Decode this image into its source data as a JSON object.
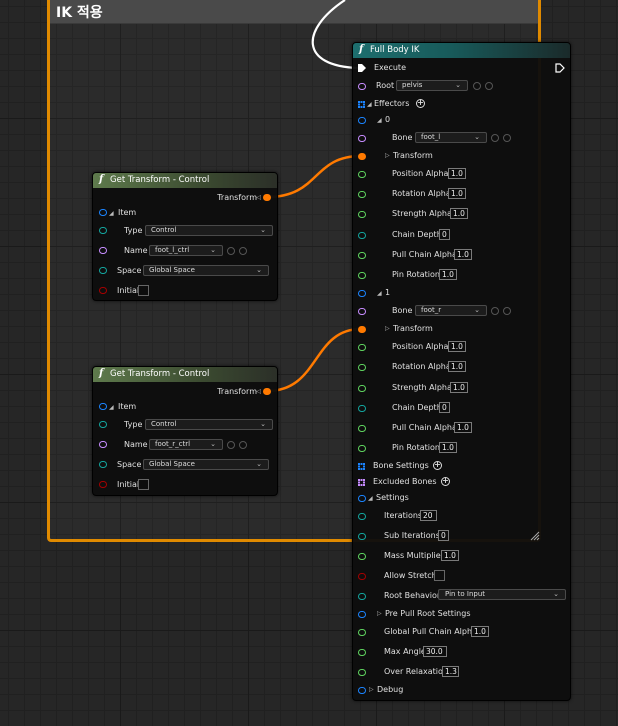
{
  "comment": {
    "title": "IK 적용"
  },
  "colors": {
    "exec": "#ffffff",
    "struct_orange": "#ff7a00",
    "bool_red": "#a50000",
    "float_green": "#5fd35f",
    "name_purple": "#c78cff",
    "enum_teal": "#13a59e",
    "struct_blue": "#1b84ff",
    "comment_border": "#e08a00"
  },
  "wire_color": "#ff7a00",
  "node1": {
    "title": "Get Transform - Control",
    "transform_label": "Transform",
    "item_label": "Item",
    "type_label": "Type",
    "type_value": "Control",
    "name_label": "Name",
    "name_value": "foot_l_ctrl",
    "space_label": "Space",
    "space_value": "Global Space",
    "initial_label": "Initial"
  },
  "node2": {
    "title": "Get Transform - Control",
    "transform_label": "Transform",
    "item_label": "Item",
    "type_label": "Type",
    "type_value": "Control",
    "name_label": "Name",
    "name_value": "foot_r_ctrl",
    "space_label": "Space",
    "space_value": "Global Space",
    "initial_label": "Initial"
  },
  "fbik": {
    "title": "Full Body IK",
    "execute_label": "Execute",
    "root_label": "Root",
    "root_value": "pelvis",
    "effectors_label": "Effectors",
    "effectors": [
      {
        "index": "0",
        "bone_label": "Bone",
        "bone_value": "foot_l",
        "transform_label": "Transform",
        "rows": [
          {
            "label": "Position Alpha",
            "value": "1.0"
          },
          {
            "label": "Rotation Alpha",
            "value": "1.0"
          },
          {
            "label": "Strength Alpha",
            "value": "1.0"
          },
          {
            "label": "Chain Depth",
            "value": "0"
          },
          {
            "label": "Pull Chain Alpha",
            "value": "1.0"
          },
          {
            "label": "Pin Rotation",
            "value": "1.0"
          }
        ]
      },
      {
        "index": "1",
        "bone_label": "Bone",
        "bone_value": "foot_r",
        "transform_label": "Transform",
        "rows": [
          {
            "label": "Position Alpha",
            "value": "1.0"
          },
          {
            "label": "Rotation Alpha",
            "value": "1.0"
          },
          {
            "label": "Strength Alpha",
            "value": "1.0"
          },
          {
            "label": "Chain Depth",
            "value": "0"
          },
          {
            "label": "Pull Chain Alpha",
            "value": "1.0"
          },
          {
            "label": "Pin Rotation",
            "value": "1.0"
          }
        ]
      }
    ],
    "bone_settings_label": "Bone Settings",
    "excluded_bones_label": "Excluded Bones",
    "settings_label": "Settings",
    "iterations_label": "Iterations",
    "iterations_value": "20",
    "sub_iterations_label": "Sub Iterations",
    "sub_iterations_value": "0",
    "mass_multiplier_label": "Mass Multiplier",
    "mass_multiplier_value": "1.0",
    "allow_stretch_label": "Allow Stretch",
    "root_behavior_label": "Root Behavior",
    "root_behavior_value": "Pin to Input",
    "pre_pull_label": "Pre Pull Root Settings",
    "global_pull_label": "Global Pull Chain Alpha",
    "global_pull_value": "1.0",
    "max_angle_label": "Max Angle",
    "max_angle_value": "30.0",
    "over_relaxation_label": "Over Relaxation",
    "over_relaxation_value": "1.3",
    "debug_label": "Debug"
  }
}
